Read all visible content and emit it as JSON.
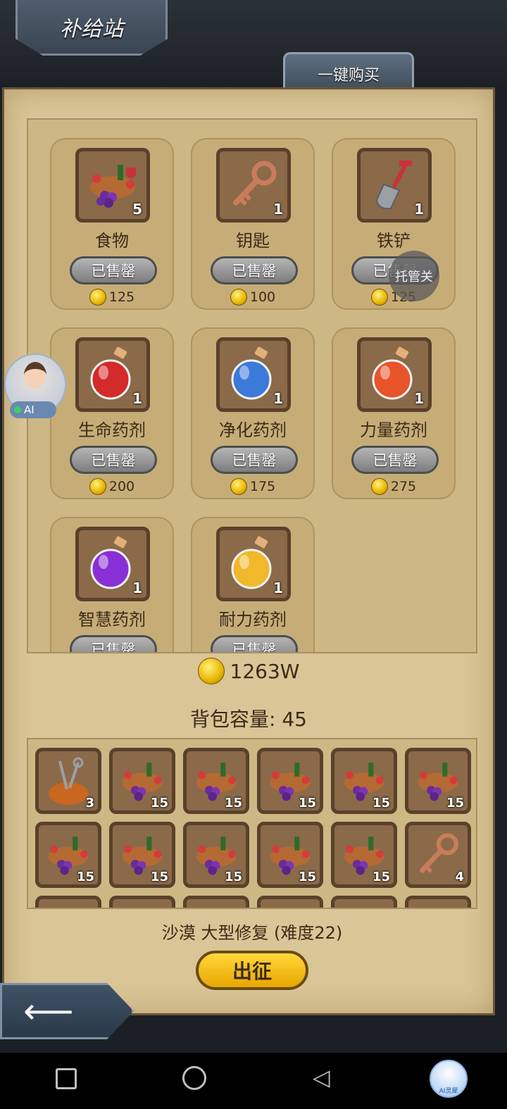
{
  "header": {
    "title": "补给站",
    "buy_all": "一键购买"
  },
  "shop": {
    "items": [
      {
        "name": "食物",
        "qty": "5",
        "status": "已售罄",
        "price": "125",
        "icon": "food-icon"
      },
      {
        "name": "钥匙",
        "qty": "1",
        "status": "已售罄",
        "price": "100",
        "icon": "key-icon"
      },
      {
        "name": "铁铲",
        "qty": "1",
        "status": "已售罄",
        "price": "125",
        "icon": "shovel-icon"
      },
      {
        "name": "生命药剂",
        "qty": "1",
        "status": "已售罄",
        "price": "200",
        "icon": "red-potion-icon",
        "color": "#d42a2a"
      },
      {
        "name": "净化药剂",
        "qty": "1",
        "status": "已售罄",
        "price": "175",
        "icon": "blue-potion-icon",
        "color": "#3b7ad9"
      },
      {
        "name": "力量药剂",
        "qty": "1",
        "status": "已售罄",
        "price": "275",
        "icon": "orange-potion-icon",
        "color": "#e8532a"
      },
      {
        "name": "智慧药剂",
        "qty": "1",
        "status": "已售罄",
        "icon": "purple-potion-icon",
        "color": "#8a2ed6"
      },
      {
        "name": "耐力药剂",
        "qty": "1",
        "status": "已售罄",
        "icon": "yellow-potion-icon",
        "color": "#f0b82a"
      }
    ]
  },
  "gold_total": "1263W",
  "capacity": "背包容量: 45",
  "bag": {
    "slots": [
      {
        "icon": "tool-bag-icon",
        "qty": "3"
      },
      {
        "icon": "food-icon",
        "qty": "15"
      },
      {
        "icon": "food-icon",
        "qty": "15"
      },
      {
        "icon": "food-icon",
        "qty": "15"
      },
      {
        "icon": "food-icon",
        "qty": "15"
      },
      {
        "icon": "food-icon",
        "qty": "15"
      },
      {
        "icon": "food-icon",
        "qty": "15"
      },
      {
        "icon": "food-icon",
        "qty": "15"
      },
      {
        "icon": "food-icon",
        "qty": "15"
      },
      {
        "icon": "food-icon",
        "qty": "15"
      },
      {
        "icon": "food-icon",
        "qty": "15"
      },
      {
        "icon": "key-icon",
        "qty": "4"
      }
    ]
  },
  "mission": "沙漠 大型修复 (难度22)",
  "go_button": "出征",
  "overlay": {
    "ai_tag": "AI",
    "tuoguan": "托管关",
    "nav_ai_label": "AI灵犀"
  },
  "colors": {
    "parchment": "#d9c596",
    "sold_button": "#9a9a9a",
    "go_button": "#f2c21a"
  }
}
